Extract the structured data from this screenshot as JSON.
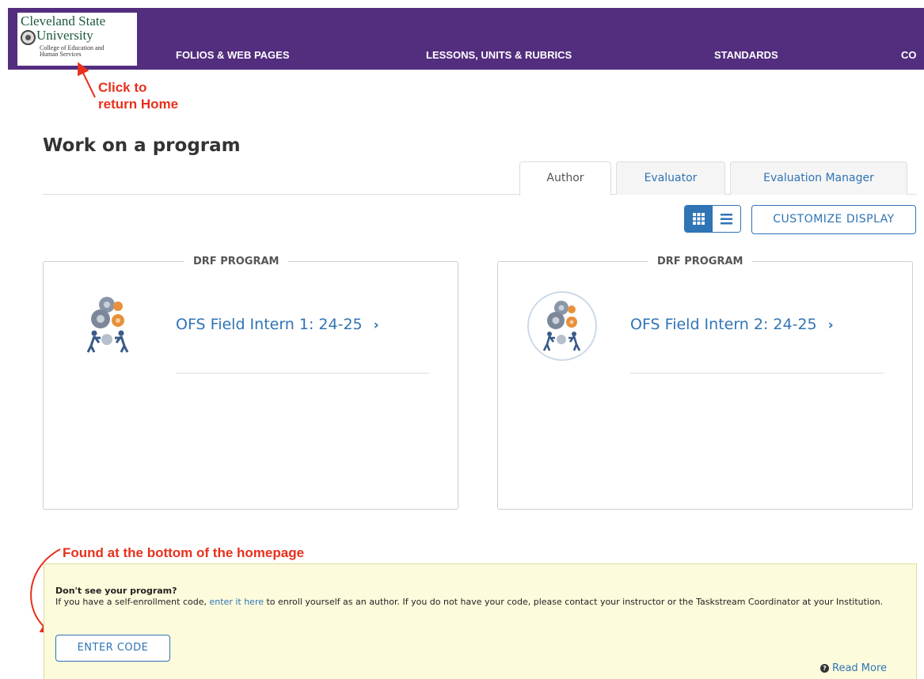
{
  "header": {
    "logo": {
      "line1": "Cleveland State",
      "line2": "University",
      "line3": "College of Education and",
      "line4": "Human Services"
    },
    "nav": [
      {
        "label": "FOLIOS & WEB PAGES"
      },
      {
        "label": "LESSONS, UNITS & RUBRICS"
      },
      {
        "label": "STANDARDS"
      },
      {
        "label": "CO"
      }
    ],
    "bar_color": "#532d7e"
  },
  "annotations": {
    "home_line1": "Click to",
    "home_line2": "return Home",
    "bottom": "Found at the bottom of the homepage",
    "color": "#e8301c"
  },
  "main": {
    "title": "Work on a program",
    "tabs": [
      {
        "label": "Author",
        "active": true
      },
      {
        "label": "Evaluator",
        "active": false
      },
      {
        "label": "Evaluation Manager",
        "active": false
      }
    ],
    "view_toggle": {
      "active": "grid",
      "grid_icon": "grid-icon",
      "list_icon": "list-icon"
    },
    "customize_label": "CUSTOMIZE DISPLAY",
    "programs": [
      {
        "type_label": "DRF PROGRAM",
        "name": "OFS Field Intern 1: 24-25",
        "chevron": "›",
        "icon": "gears-people-icon"
      },
      {
        "type_label": "DRF PROGRAM",
        "name": "OFS Field Intern 2: 24-25",
        "chevron": "›",
        "icon": "gears-people-icon"
      }
    ]
  },
  "info_box": {
    "title": "Don't see your program?",
    "text_before": "If you have a self-enrollment code, ",
    "link": "enter it here",
    "text_after": " to enroll yourself as an author. If you do not have your code, please contact your instructor or the Taskstream Coordinator at your Institution.",
    "enter_code_label": "ENTER CODE",
    "read_more_label": "Read More",
    "read_more_icon": "?"
  },
  "colors": {
    "link": "#2f74b5",
    "info_bg": "#fcfbdc"
  }
}
